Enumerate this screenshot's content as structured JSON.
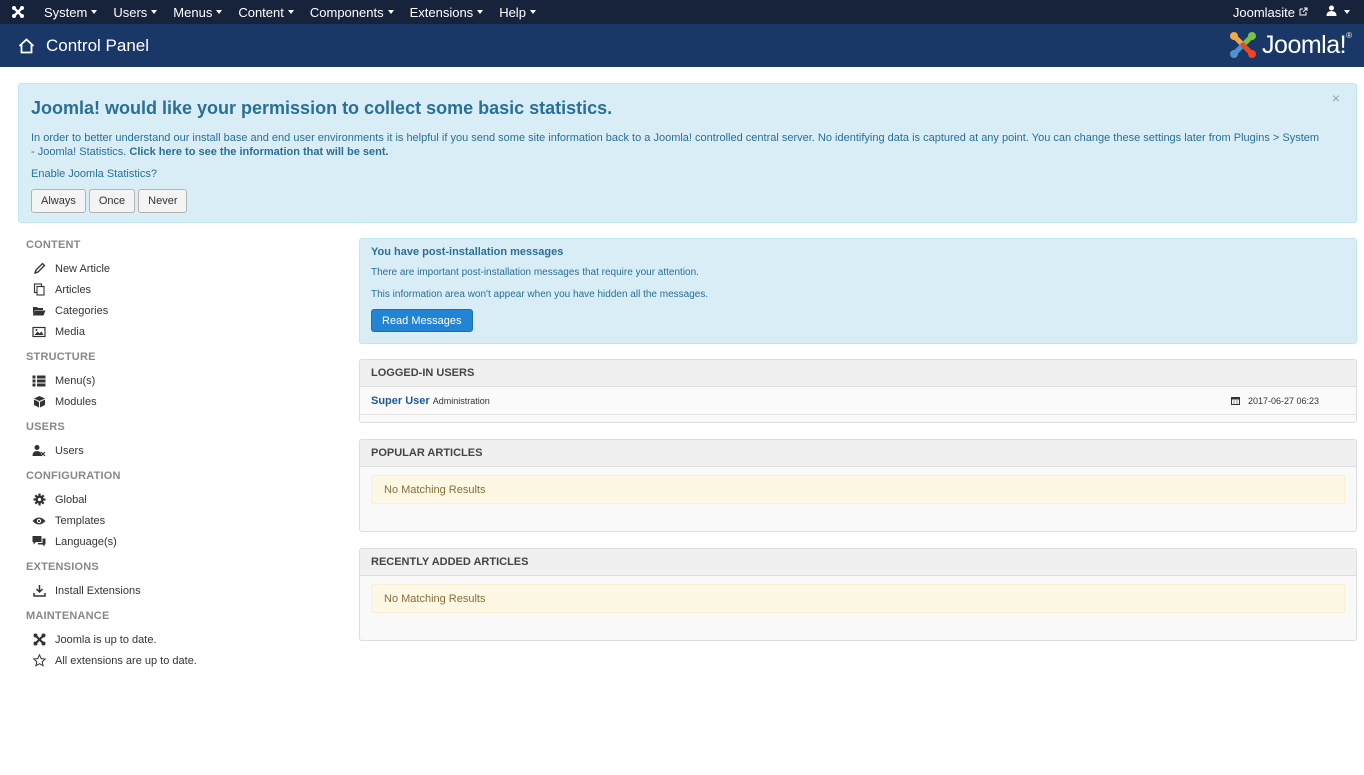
{
  "nav": {
    "menu": [
      {
        "label": "System"
      },
      {
        "label": "Users"
      },
      {
        "label": "Menus"
      },
      {
        "label": "Content"
      },
      {
        "label": "Components"
      },
      {
        "label": "Extensions"
      },
      {
        "label": "Help"
      }
    ],
    "site_label": "Joomlasite",
    "logo_icon": "joomla-icon",
    "user_icon": "user-icon"
  },
  "header": {
    "title": "Control Panel",
    "brand": "Joomla!",
    "brand_reg": "®"
  },
  "stats_alert": {
    "title": "Joomla! would like your permission to collect some basic statistics.",
    "body": "In order to better understand our install base and end user environments it is helpful if you send some site information back to a Joomla! controlled central server. No identifying data is captured at any point. You can change these settings later from Plugins > System - Joomla! Statistics.",
    "link": "Click here to see the information that will be sent.",
    "question": "Enable Joomla Statistics?",
    "buttons": {
      "always": "Always",
      "once": "Once",
      "never": "Never"
    },
    "close": "×"
  },
  "sidebar": {
    "content": {
      "heading": "CONTENT",
      "items": [
        "New Article",
        "Articles",
        "Categories",
        "Media"
      ]
    },
    "structure": {
      "heading": "STRUCTURE",
      "items": [
        "Menu(s)",
        "Modules"
      ]
    },
    "users": {
      "heading": "USERS",
      "items": [
        "Users"
      ]
    },
    "configuration": {
      "heading": "CONFIGURATION",
      "items": [
        "Global",
        "Templates",
        "Language(s)"
      ]
    },
    "extensions": {
      "heading": "EXTENSIONS",
      "items": [
        "Install Extensions"
      ]
    },
    "maintenance": {
      "heading": "MAINTENANCE",
      "items": [
        "Joomla is up to date.",
        "All extensions are up to date."
      ]
    }
  },
  "post_install": {
    "title": "You have post-installation messages",
    "line1": "There are important post-installation messages that require your attention.",
    "line2": "This information area won't appear when you have hidden all the messages.",
    "button": "Read Messages"
  },
  "logged_in": {
    "heading": "LOGGED-IN USERS",
    "user": "Super User",
    "role": "Administration",
    "date": "2017-06-27 06:23"
  },
  "popular": {
    "heading": "POPULAR ARTICLES",
    "empty": "No Matching Results"
  },
  "recent": {
    "heading": "RECENTLY ADDED ARTICLES",
    "empty": "No Matching Results"
  }
}
